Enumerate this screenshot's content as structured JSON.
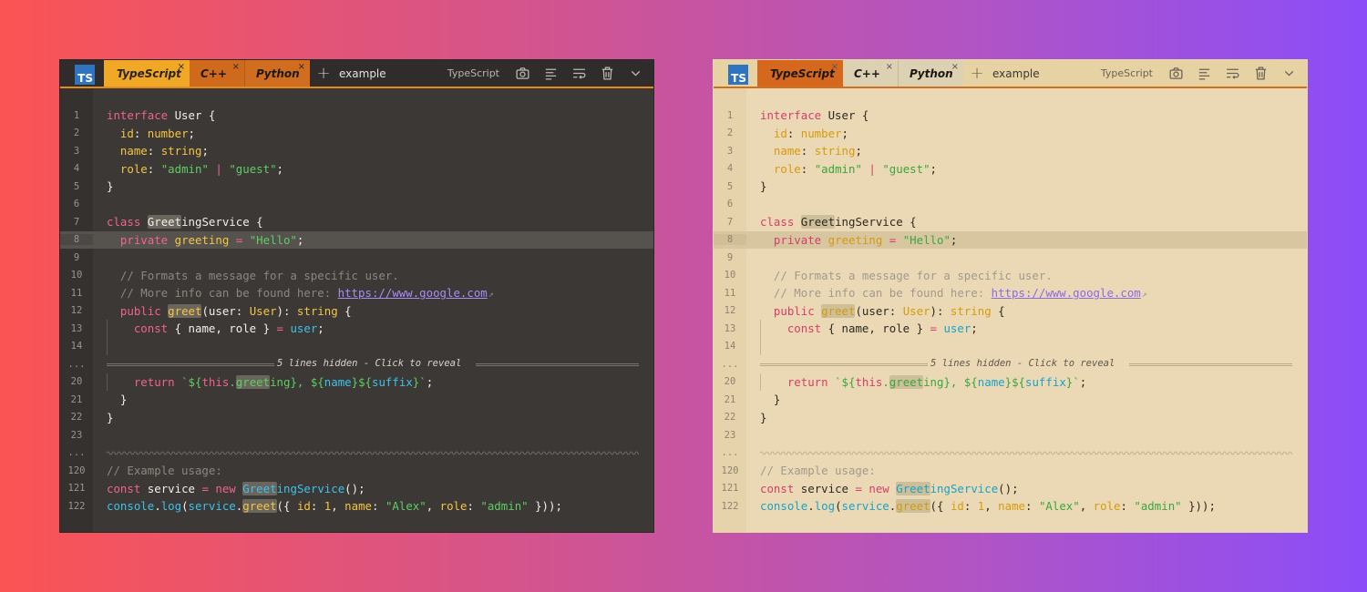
{
  "colors": {
    "dark_bg": "#3b3836",
    "light_bg": "#ead9b4",
    "accent_orange": "#e58a1f",
    "ts_blue": "#2f74c0"
  },
  "editors": [
    {
      "theme": "dark",
      "logo": "TS",
      "tabs": [
        {
          "label": "TypeScript",
          "close": "×"
        },
        {
          "label": "C++",
          "close": "×"
        },
        {
          "label": "Python",
          "close": "×"
        }
      ],
      "plus": "+",
      "title": "example",
      "language": "TypeScript"
    },
    {
      "theme": "light",
      "logo": "TS",
      "tabs": [
        {
          "label": "TypeScript",
          "close": "×"
        },
        {
          "label": "C++",
          "close": "×"
        },
        {
          "label": "Python",
          "close": "×"
        }
      ],
      "plus": "+",
      "title": "example",
      "language": "TypeScript"
    }
  ],
  "tool_icons": [
    "camera-icon",
    "align-icon",
    "wrap-icon",
    "trash-icon",
    "chevron-down-icon"
  ],
  "code": {
    "lines": [
      {
        "n": "1",
        "tokens": [
          [
            "k",
            "interface"
          ],
          [
            "p",
            " User {"
          ]
        ]
      },
      {
        "n": "2",
        "tokens": [
          [
            "p",
            "  "
          ],
          [
            "t",
            "id"
          ],
          [
            "p",
            ": "
          ],
          [
            "t",
            "number"
          ],
          [
            "p",
            ";"
          ]
        ]
      },
      {
        "n": "3",
        "tokens": [
          [
            "p",
            "  "
          ],
          [
            "t",
            "name"
          ],
          [
            "p",
            ": "
          ],
          [
            "t",
            "string"
          ],
          [
            "p",
            ";"
          ]
        ]
      },
      {
        "n": "4",
        "tokens": [
          [
            "p",
            "  "
          ],
          [
            "t",
            "role"
          ],
          [
            "p",
            ": "
          ],
          [
            "s",
            "\"admin\""
          ],
          [
            "p",
            " "
          ],
          [
            "op",
            "|"
          ],
          [
            "p",
            " "
          ],
          [
            "s",
            "\"guest\""
          ],
          [
            "p",
            ";"
          ]
        ]
      },
      {
        "n": "5",
        "tokens": [
          [
            "p",
            "}"
          ]
        ]
      },
      {
        "n": "6",
        "tokens": []
      },
      {
        "n": "7",
        "tokens": [
          [
            "k",
            "class"
          ],
          [
            "p",
            " "
          ],
          [
            "mark",
            "Greet"
          ],
          [
            "p",
            "ingService {"
          ]
        ]
      },
      {
        "n": "8",
        "hl": true,
        "tokens": [
          [
            "p",
            "  "
          ],
          [
            "k",
            "private"
          ],
          [
            "p",
            " "
          ],
          [
            "t",
            "greeting"
          ],
          [
            "p",
            " "
          ],
          [
            "op",
            "="
          ],
          [
            "p",
            " "
          ],
          [
            "s",
            "\"Hello\""
          ],
          [
            "p",
            ";"
          ]
        ]
      },
      {
        "n": "9",
        "tokens": []
      },
      {
        "n": "10",
        "tokens": [
          [
            "c",
            "  // Formats a message for a specific user."
          ]
        ]
      },
      {
        "n": "11",
        "tokens": [
          [
            "c",
            "  // More info can be found here: "
          ],
          [
            "link",
            "https://www.google.com"
          ],
          [
            "ext",
            "↗"
          ]
        ]
      },
      {
        "n": "12",
        "tokens": [
          [
            "p",
            "  "
          ],
          [
            "k",
            "public"
          ],
          [
            "p",
            " "
          ],
          [
            "fmark",
            "greet"
          ],
          [
            "p",
            "(user: "
          ],
          [
            "t",
            "User"
          ],
          [
            "p",
            "): "
          ],
          [
            "t",
            "string"
          ],
          [
            "p",
            " {"
          ]
        ]
      },
      {
        "n": "13",
        "bar": true,
        "tokens": [
          [
            "p",
            "    "
          ],
          [
            "k",
            "const"
          ],
          [
            "p",
            " { name, role } "
          ],
          [
            "op",
            "="
          ],
          [
            "p",
            " "
          ],
          [
            "v",
            "user"
          ],
          [
            "p",
            ";"
          ]
        ]
      },
      {
        "n": "14",
        "bar": true,
        "tokens": []
      },
      {
        "n": "...",
        "hidden": "5 lines hidden - Click to reveal"
      },
      {
        "n": "20",
        "bar": true,
        "tokens": [
          [
            "p",
            "    "
          ],
          [
            "k",
            "return"
          ],
          [
            "p",
            " "
          ],
          [
            "s",
            "`${"
          ],
          [
            "k",
            "this"
          ],
          [
            "s",
            "."
          ],
          [
            "smark",
            "greet"
          ],
          [
            "s",
            "ing}, ${"
          ],
          [
            "v",
            "name"
          ],
          [
            "s",
            "}${"
          ],
          [
            "v",
            "suffix"
          ],
          [
            "s",
            "}`"
          ],
          [
            "p",
            ";"
          ]
        ]
      },
      {
        "n": "21",
        "tokens": [
          [
            "p",
            "  }"
          ]
        ]
      },
      {
        "n": "22",
        "tokens": [
          [
            "p",
            "}"
          ]
        ]
      },
      {
        "n": "23",
        "tokens": []
      },
      {
        "n": "...",
        "wavy": true
      },
      {
        "n": "120",
        "tokens": [
          [
            "c",
            "// Example usage:"
          ]
        ]
      },
      {
        "n": "121",
        "tokens": [
          [
            "k",
            "const"
          ],
          [
            "p",
            " service "
          ],
          [
            "op",
            "="
          ],
          [
            "p",
            " "
          ],
          [
            "k",
            "new"
          ],
          [
            "p",
            " "
          ],
          [
            "vmark",
            "Greet"
          ],
          [
            "v",
            "ingService"
          ],
          [
            "p",
            "();"
          ]
        ]
      },
      {
        "n": "122",
        "tokens": [
          [
            "v",
            "console"
          ],
          [
            "p",
            "."
          ],
          [
            "v",
            "log"
          ],
          [
            "p",
            "("
          ],
          [
            "v",
            "service"
          ],
          [
            "p",
            "."
          ],
          [
            "fmark",
            "greet"
          ],
          [
            "p",
            "({ "
          ],
          [
            "t",
            "id"
          ],
          [
            "p",
            ": "
          ],
          [
            "m",
            "1"
          ],
          [
            "p",
            ", "
          ],
          [
            "t",
            "name"
          ],
          [
            "p",
            ": "
          ],
          [
            "s",
            "\"Alex\""
          ],
          [
            "p",
            ", "
          ],
          [
            "t",
            "role"
          ],
          [
            "p",
            ": "
          ],
          [
            "s",
            "\"admin\""
          ],
          [
            "p",
            " }));"
          ]
        ]
      }
    ]
  }
}
